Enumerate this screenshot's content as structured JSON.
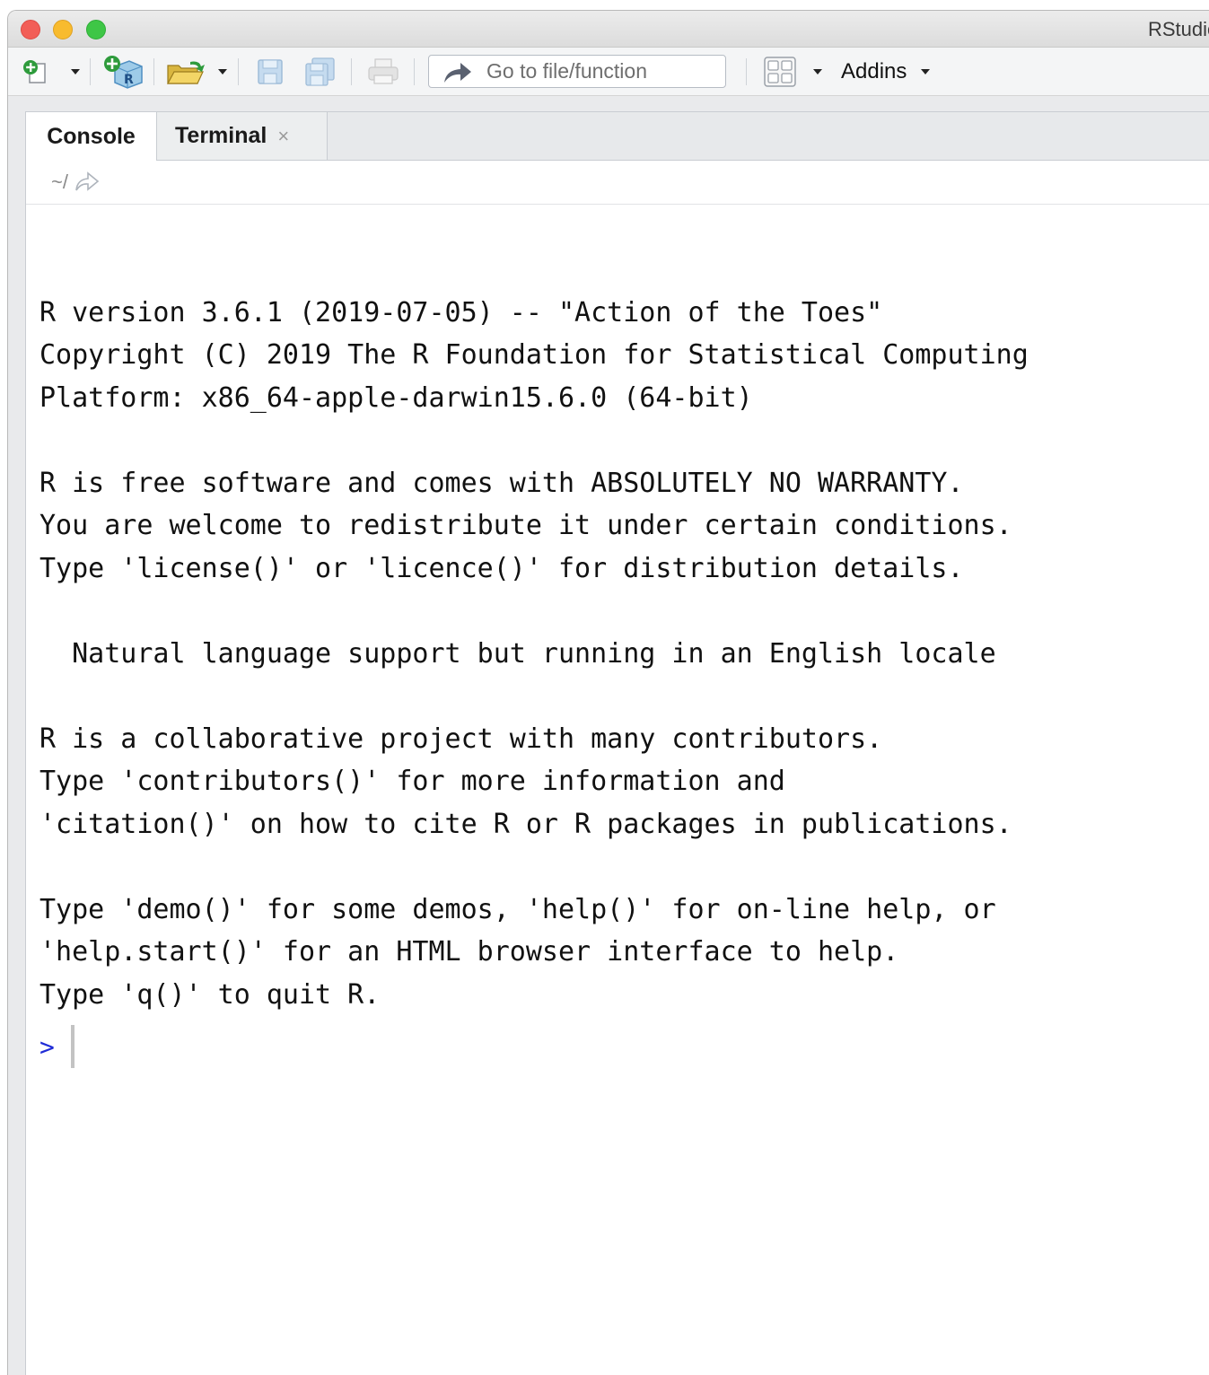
{
  "window": {
    "title": "RStudio"
  },
  "toolbar": {
    "goto_placeholder": "Go to file/function",
    "addins_label": "Addins"
  },
  "tabs": [
    {
      "label": "Console",
      "active": true
    },
    {
      "label": "Terminal",
      "closable": true,
      "close_glyph": "×"
    }
  ],
  "path": "~/",
  "console": {
    "lines": [
      "",
      "R version 3.6.1 (2019-07-05) -- \"Action of the Toes\"",
      "Copyright (C) 2019 The R Foundation for Statistical Computing",
      "Platform: x86_64-apple-darwin15.6.0 (64-bit)",
      "",
      "R is free software and comes with ABSOLUTELY NO WARRANTY.",
      "You are welcome to redistribute it under certain conditions.",
      "Type 'license()' or 'licence()' for distribution details.",
      "",
      "  Natural language support but running in an English locale",
      "",
      "R is a collaborative project with many contributors.",
      "Type 'contributors()' for more information and",
      "'citation()' on how to cite R or R packages in publications.",
      "",
      "Type 'demo()' for some demos, 'help()' for on-line help, or",
      "'help.start()' for an HTML browser interface to help.",
      "Type 'q()' to quit R."
    ],
    "prompt": ">"
  },
  "colors": {
    "prompt": "#1f2bd6",
    "accent_green": "#2e9b3c"
  }
}
